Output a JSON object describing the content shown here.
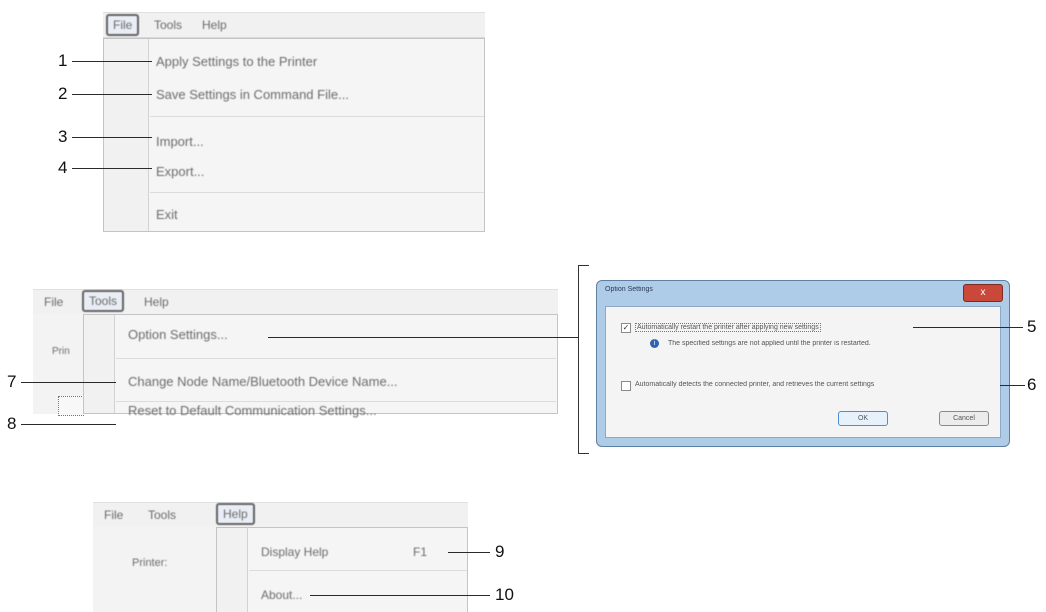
{
  "file_menu": {
    "menubar": [
      "File",
      "Tools",
      "Help"
    ],
    "items": [
      "Apply Settings to the Printer",
      "Save Settings in Command File...",
      "Import...",
      "Export...",
      "Exit"
    ]
  },
  "tools_menu": {
    "menubar": [
      "File",
      "Tools",
      "Help"
    ],
    "side_label": "Prin",
    "items": [
      "Option Settings...",
      "Change Node Name/Bluetooth Device Name...",
      "Reset to Default Communication Settings..."
    ]
  },
  "option_dialog": {
    "title": "Option Settings",
    "close_glyph": "x",
    "restart_checkbox_label": "Automatically restart the printer after applying new settings",
    "restart_checked": true,
    "info_note": "The specified settings are not applied until the printer is restarted.",
    "detect_checkbox_label": "Automatically detects the connected printer, and retrieves the current settings",
    "detect_checked": false,
    "ok_label": "OK",
    "cancel_label": "Cancel"
  },
  "help_menu": {
    "menubar": [
      "File",
      "Tools",
      "Help"
    ],
    "side_label": "Printer:",
    "items": [
      {
        "label": "Display Help",
        "shortcut": "F1"
      },
      {
        "label": "About..."
      }
    ]
  },
  "callouts": [
    "1",
    "2",
    "3",
    "4",
    "5",
    "6",
    "7",
    "8",
    "9",
    "10"
  ]
}
